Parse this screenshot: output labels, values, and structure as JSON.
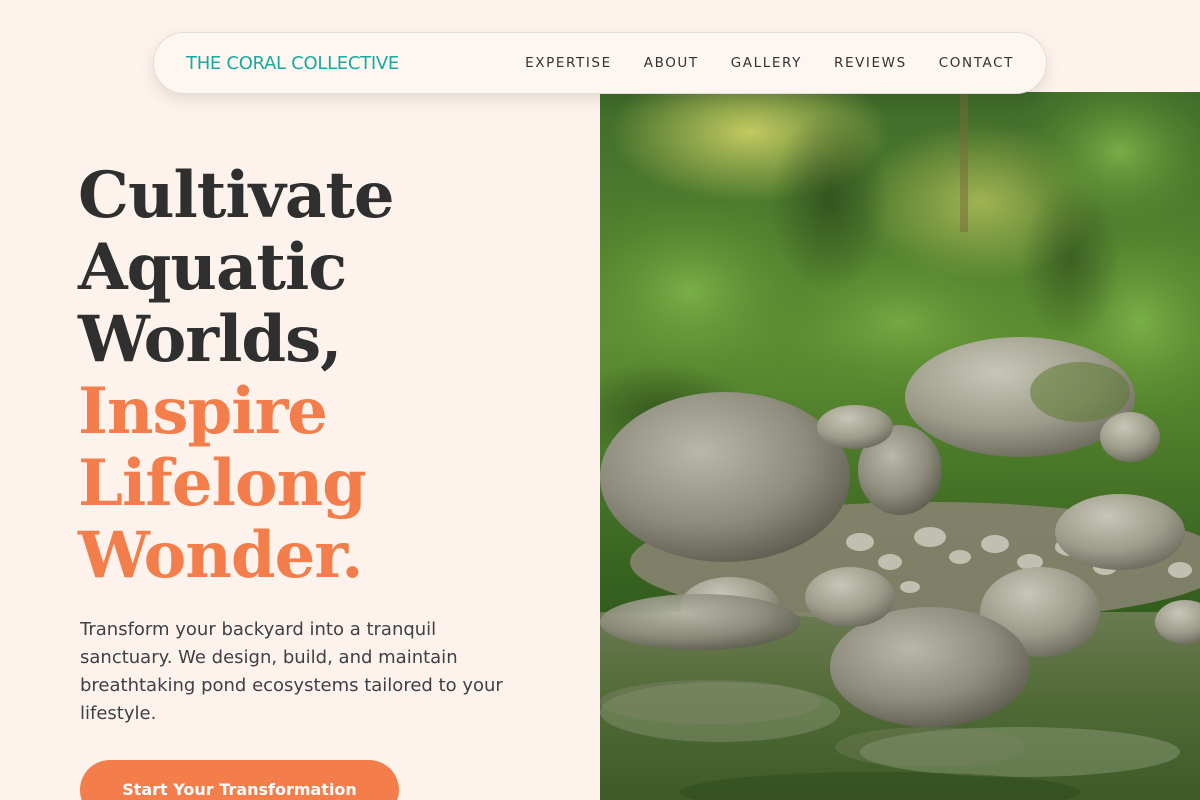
{
  "brand": {
    "name": "THE CORAL COLLECTIVE",
    "color": "#1aa9a0"
  },
  "nav": {
    "links": [
      {
        "label": "EXPERTISE"
      },
      {
        "label": "ABOUT"
      },
      {
        "label": "GALLERY"
      },
      {
        "label": "REVIEWS"
      },
      {
        "label": "CONTACT"
      }
    ]
  },
  "hero": {
    "headline_dark": [
      "Cultivate",
      "Aquatic",
      "Worlds,"
    ],
    "headline_accent": [
      "Inspire",
      "Lifelong",
      "Wonder."
    ],
    "subtext": "Transform your backyard into a tranquil sanctuary. We design, build, and maintain breathtaking pond ecosystems tailored to your lifestyle.",
    "cta_label": "Start Your Transformation",
    "image": "rocky-stream-photo"
  },
  "colors": {
    "background": "#fdf3ec",
    "accent": "#f37e4b",
    "text_dark": "#2f2f2f"
  }
}
